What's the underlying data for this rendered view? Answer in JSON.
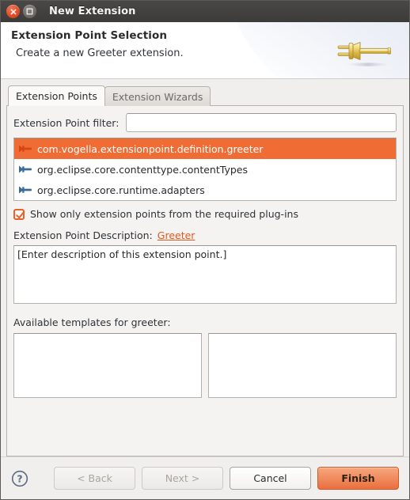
{
  "window": {
    "title": "New Extension",
    "controls": [
      {
        "name": "close-button",
        "icon": "close-icon"
      },
      {
        "name": "maximize-button",
        "icon": "maximize-icon"
      }
    ]
  },
  "header": {
    "title": "Extension Point Selection",
    "subtitle": "Create a new Greeter extension.",
    "icon": "plug-icon"
  },
  "tabs": [
    {
      "label": "Extension Points",
      "active": true
    },
    {
      "label": "Extension Wizards",
      "active": false
    }
  ],
  "filter": {
    "label": "Extension Point filter:",
    "value": "",
    "placeholder": ""
  },
  "extension_points": [
    {
      "label": "com.vogella.extensionpoint.definition.greeter",
      "selected": true,
      "icon": "extension-point-icon"
    },
    {
      "label": "org.eclipse.core.contenttype.contentTypes",
      "selected": false,
      "icon": "extension-point-icon"
    },
    {
      "label": "org.eclipse.core.runtime.adapters",
      "selected": false,
      "icon": "extension-point-icon"
    }
  ],
  "required_plugins_checkbox": {
    "label": "Show only extension points from the required plug-ins",
    "checked": true
  },
  "description": {
    "label": "Extension Point Description:",
    "link": "Greeter",
    "text": "[Enter description of this extension point.]"
  },
  "templates": {
    "label": "Available templates for greeter:",
    "left_items": [],
    "right_items": []
  },
  "buttons": {
    "help": "help-icon",
    "back": "< Back",
    "next": "Next >",
    "cancel": "Cancel",
    "finish": "Finish"
  },
  "colors": {
    "accent_orange": "#ef6c35",
    "link_orange": "#e2571d",
    "titlebar_dark": "#3c3b39",
    "close_red": "#e04e27",
    "body_gray": "#f0efed",
    "default_button_orange": "#f08d60"
  }
}
